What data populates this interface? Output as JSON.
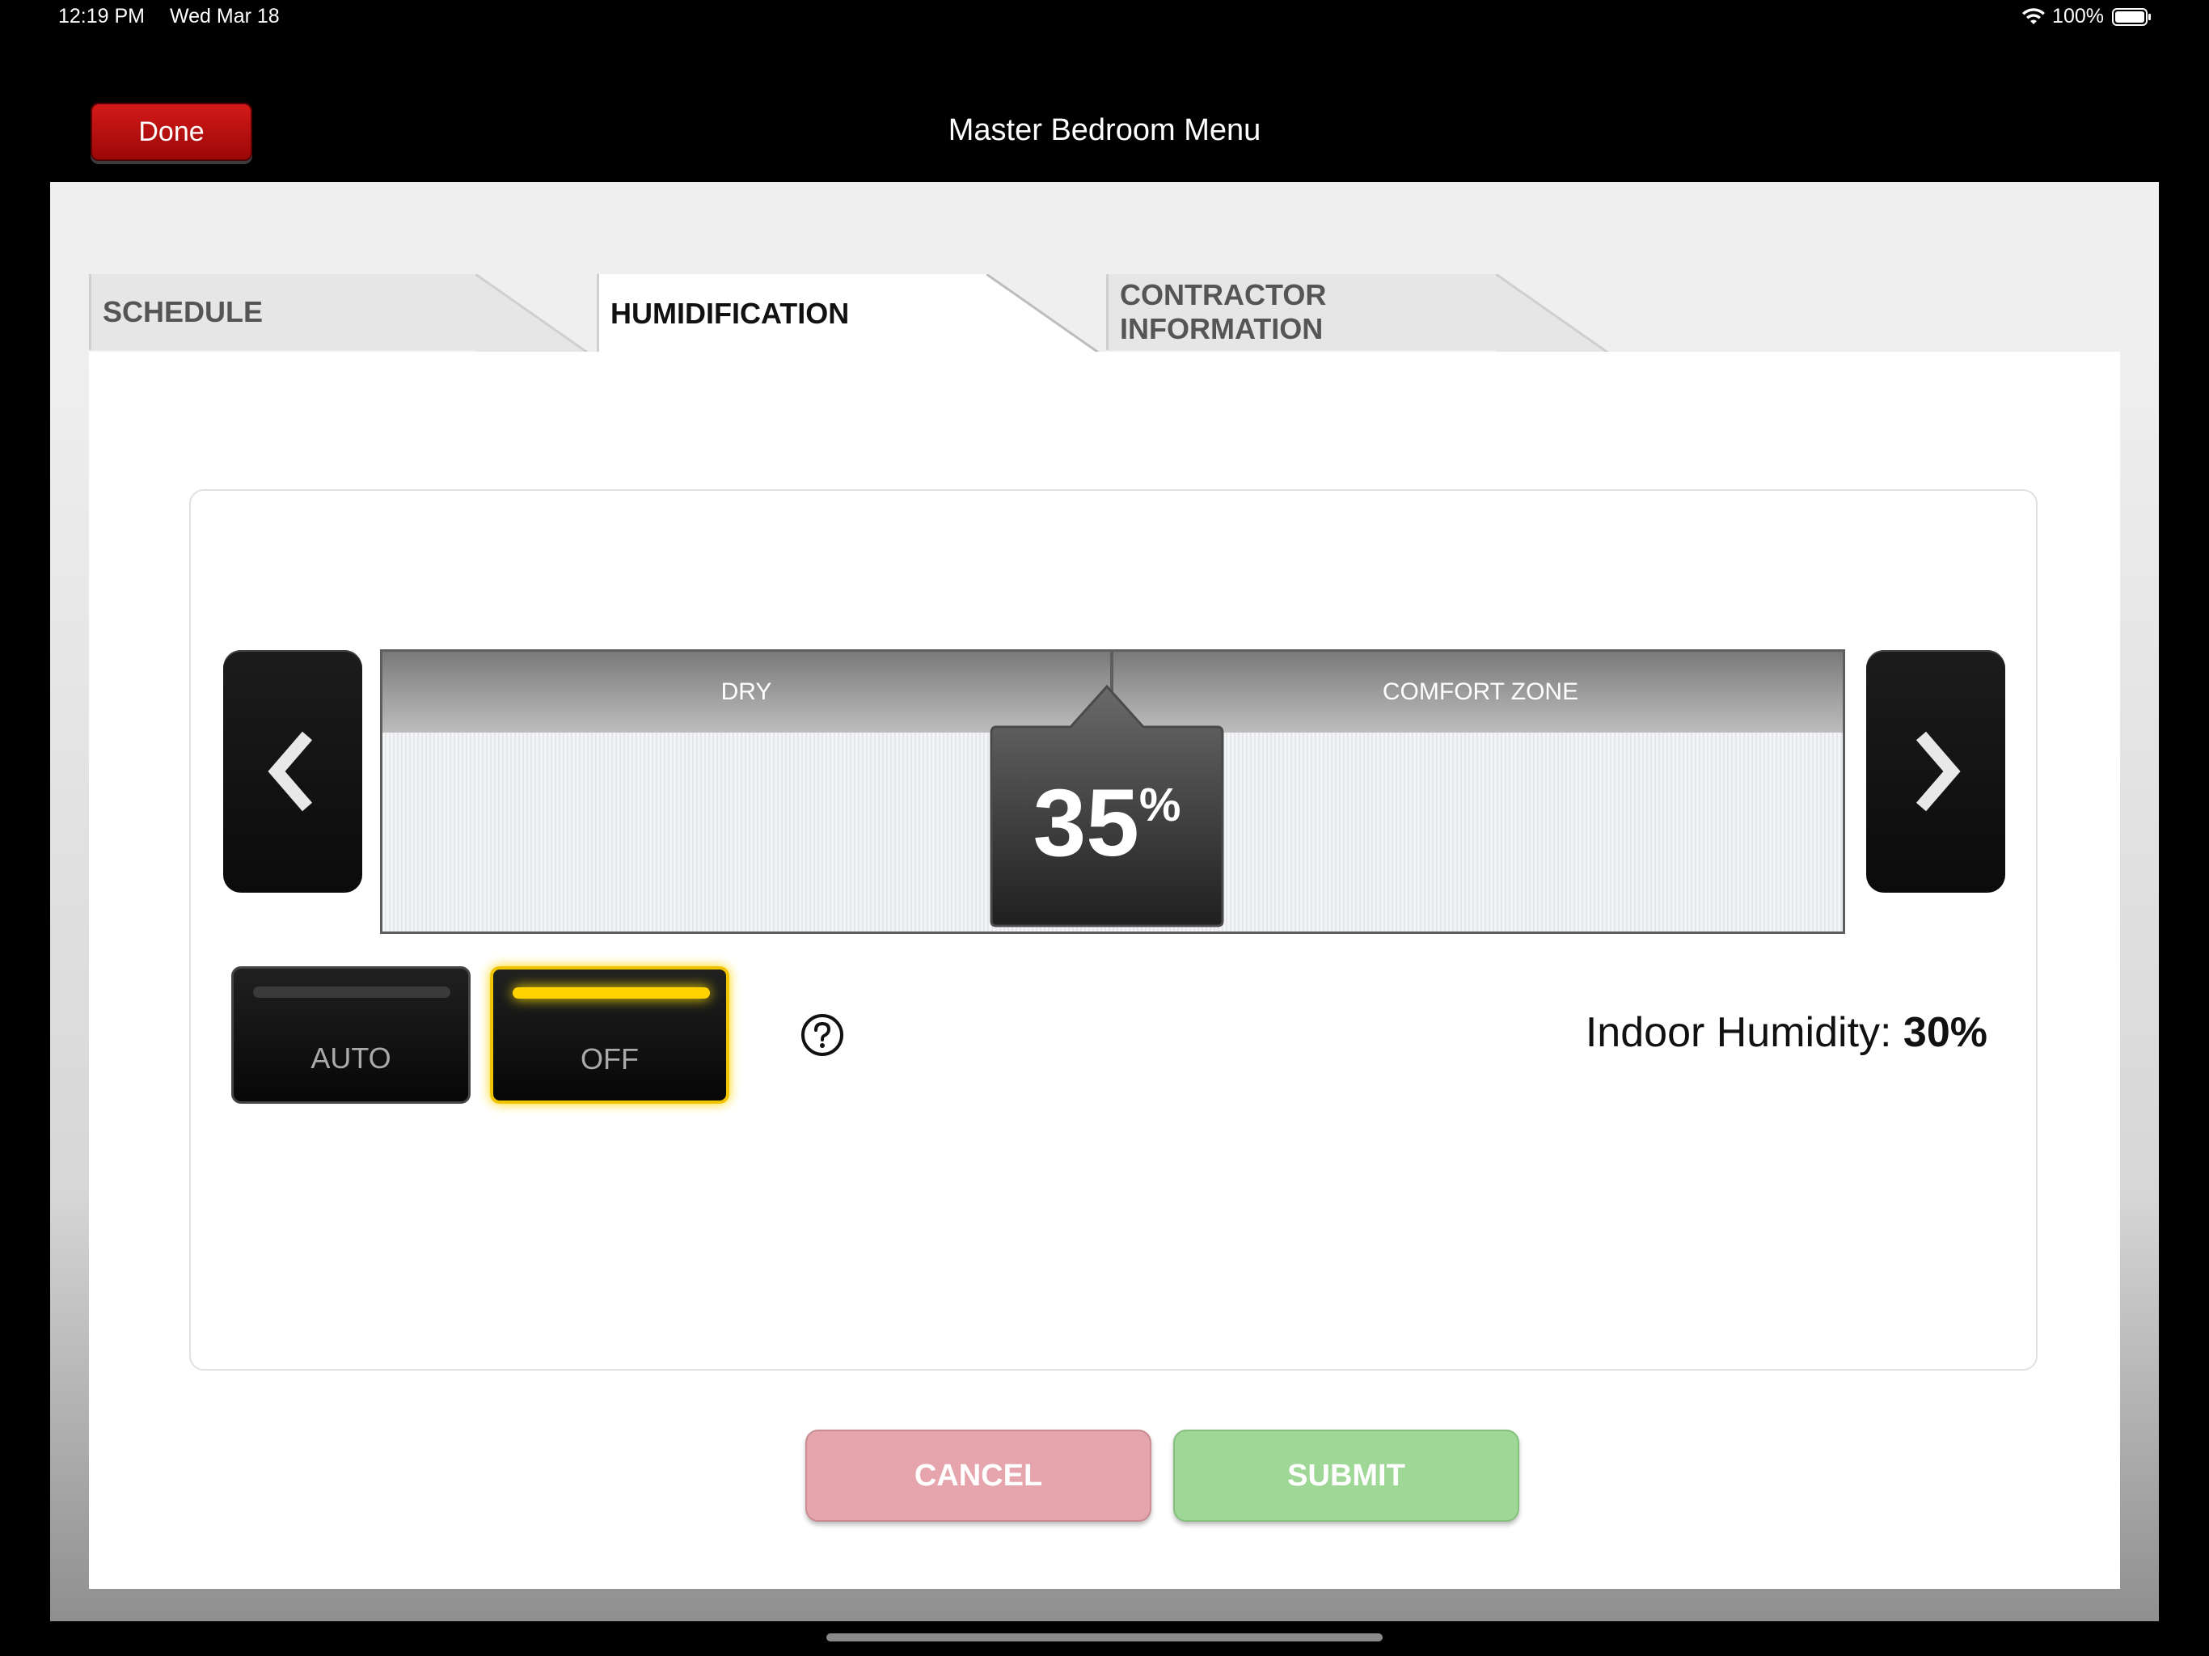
{
  "status_bar": {
    "time": "12:19 PM",
    "date": "Wed Mar 18",
    "battery": "100%"
  },
  "nav": {
    "done_label": "Done",
    "title": "Master Bedroom Menu"
  },
  "tabs": [
    {
      "label": "SCHEDULE",
      "active": false
    },
    {
      "label": "HUMIDIFICATION",
      "active": true
    },
    {
      "label": "CONTRACTOR INFORMATION",
      "active": false
    }
  ],
  "humidity": {
    "zones": [
      "DRY",
      "COMFORT ZONE"
    ],
    "setpoint": "35",
    "setpoint_unit": "%",
    "modes": [
      {
        "label": "AUTO",
        "selected": false
      },
      {
        "label": "OFF",
        "selected": true
      }
    ],
    "indoor_label": "Indoor Humidity:",
    "indoor_value": "30%"
  },
  "actions": {
    "cancel_label": "CANCEL",
    "submit_label": "SUBMIT"
  },
  "colors": {
    "done": "#b80e0e",
    "selected_mode": "#ffd200",
    "cancel": "#e6a5ad",
    "submit": "#9ed796"
  }
}
